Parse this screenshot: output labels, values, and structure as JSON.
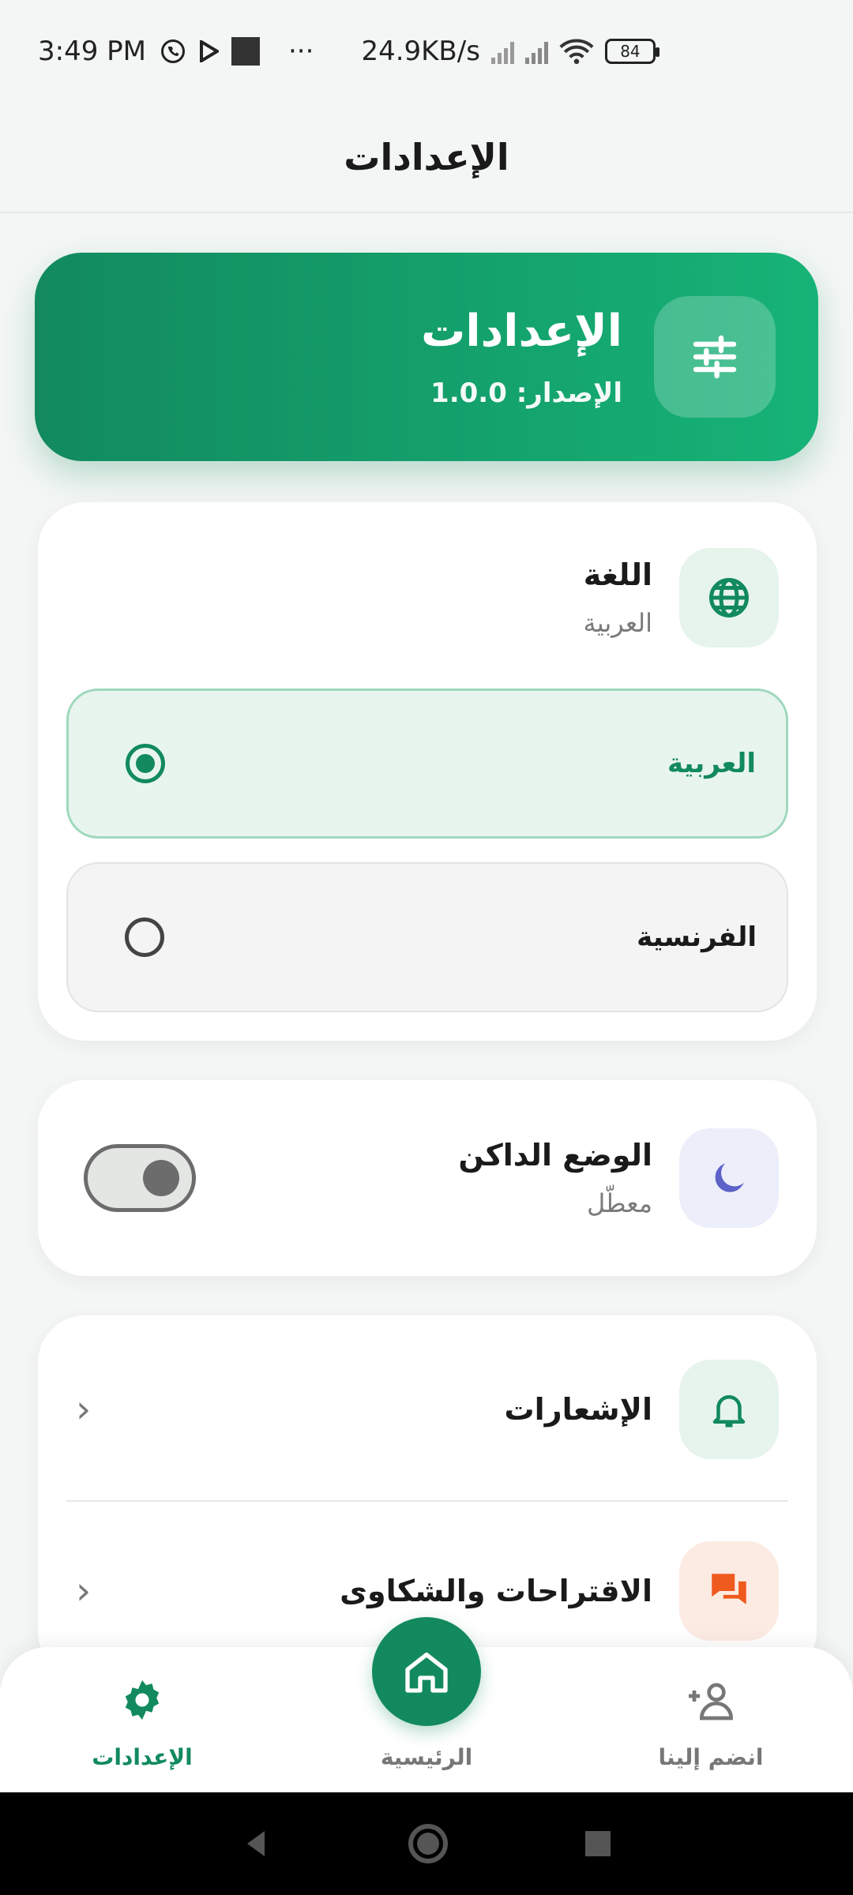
{
  "status_bar": {
    "time": "3:49 PM",
    "dots": "···",
    "speed": "24.9KB/s",
    "battery": "84"
  },
  "appbar": {
    "title": "الإعدادات"
  },
  "hero": {
    "title": "الإعدادات",
    "version": "الإصدار: 1.0.0"
  },
  "language": {
    "title": "اللغة",
    "current": "العربية",
    "options": [
      {
        "label": "العربية",
        "selected": true
      },
      {
        "label": "الفرنسية",
        "selected": false
      }
    ]
  },
  "dark_mode": {
    "title": "الوضع الداكن",
    "status": "معطّل",
    "enabled": false
  },
  "menu": [
    {
      "label": "الإشعارات",
      "icon": "bell-icon"
    },
    {
      "label": "الاقتراحات والشكاوى",
      "icon": "chat-icon"
    }
  ],
  "bottom_nav": {
    "settings": "الإعدادات",
    "home": "الرئيسية",
    "join": "انضم إلينا"
  },
  "colors": {
    "primary": "#128a5e",
    "accent_orange": "#ef5a1e",
    "moon": "#5c62c8"
  }
}
